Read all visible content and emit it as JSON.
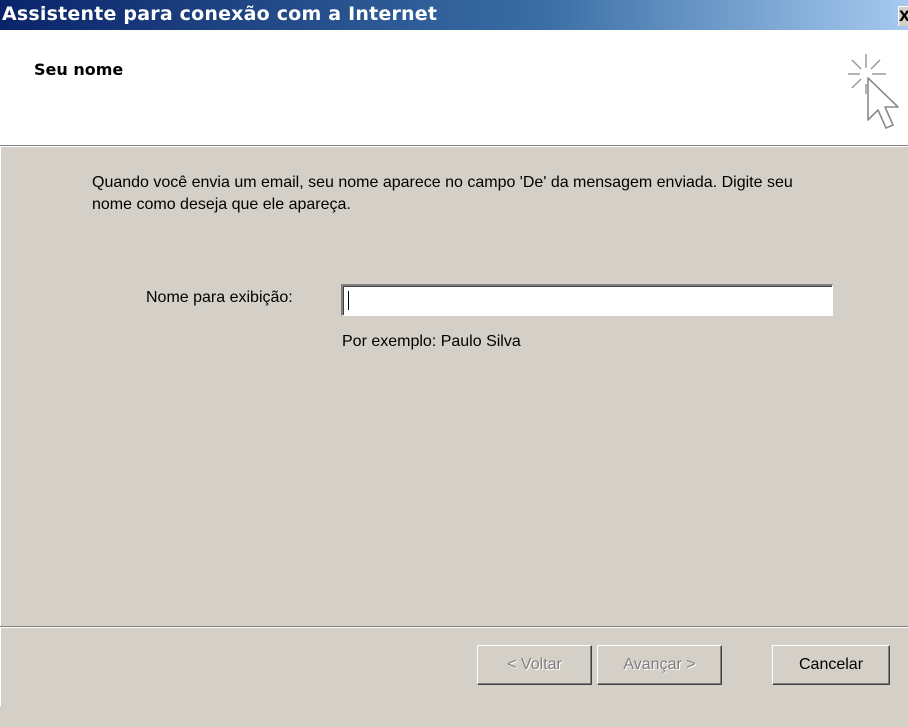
{
  "window": {
    "title": "Assistente para conexão com a Internet",
    "close_label": "X"
  },
  "header": {
    "title": "Seu nome",
    "icon": "wizard-cursor-icon"
  },
  "main": {
    "instructions": "Quando você envia um email, seu nome aparece no campo 'De' da mensagem enviada. Digite seu nome como deseja que ele apareça.",
    "display_name": {
      "label": "Nome para exibição:",
      "value": "",
      "example": "Por exemplo: Paulo Silva"
    }
  },
  "footer": {
    "back_label": "< Voltar",
    "next_label": "Avançar >",
    "cancel_label": "Cancelar"
  },
  "colors": {
    "titlebar_start": "#0a246a",
    "titlebar_end": "#a6caf0",
    "dialog_bg": "#d4d0c8",
    "header_bg": "#ffffff"
  }
}
